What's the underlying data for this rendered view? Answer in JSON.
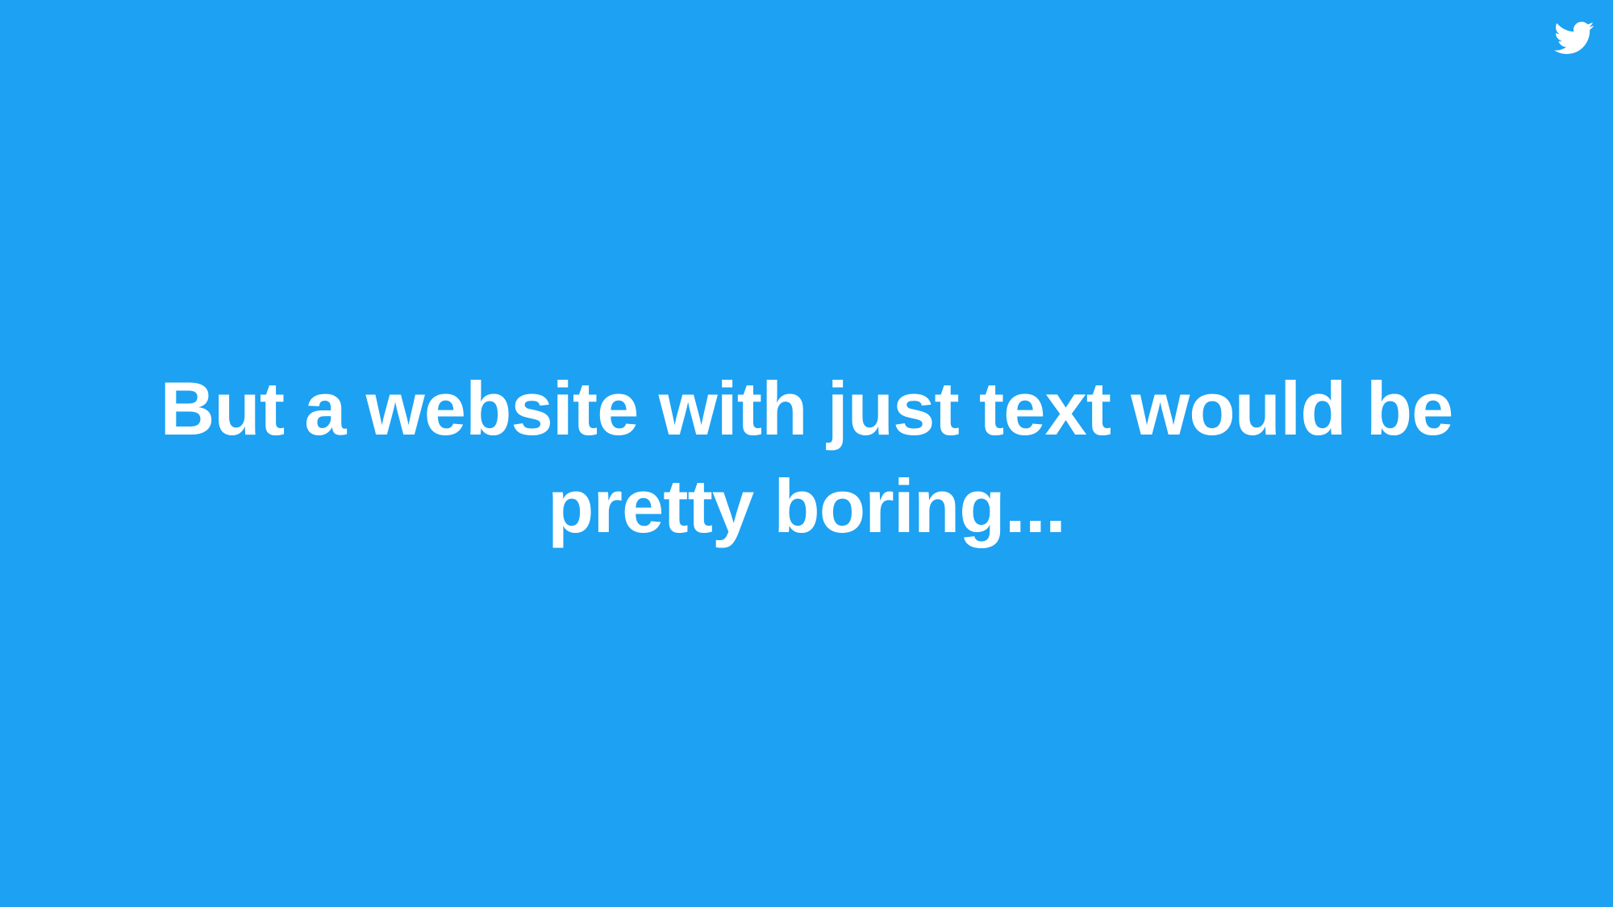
{
  "slide": {
    "background_color": "#1DA1F2",
    "text_color": "#FFFFFF",
    "logo_icon": "twitter-bird-icon",
    "headline": {
      "line1": "But a website with just text would be",
      "line2": "pretty boring..."
    }
  }
}
